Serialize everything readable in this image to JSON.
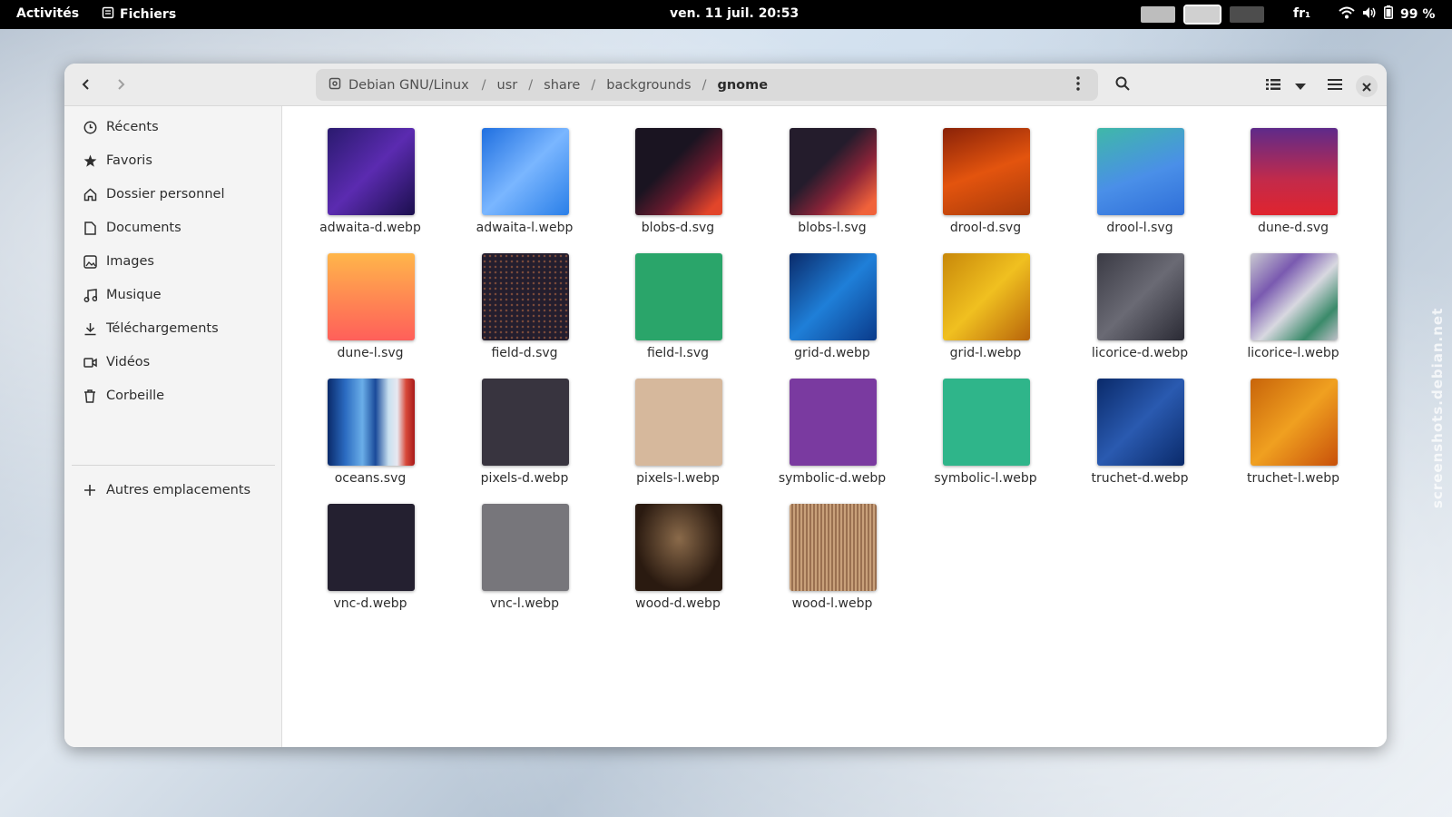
{
  "topbar": {
    "activities": "Activités",
    "app_name": "Fichiers",
    "clock": "ven. 11 juil.  20:53",
    "lang": "fr₁",
    "battery": "99 %"
  },
  "window": {
    "path": {
      "root": "Debian GNU/Linux",
      "segments": [
        "usr",
        "share",
        "backgrounds"
      ],
      "current": "gnome"
    }
  },
  "sidebar": {
    "items": [
      {
        "label": "Récents",
        "icon": "clock-icon"
      },
      {
        "label": "Favoris",
        "icon": "star-icon"
      },
      {
        "label": "Dossier personnel",
        "icon": "home-icon"
      },
      {
        "label": "Documents",
        "icon": "document-icon"
      },
      {
        "label": "Images",
        "icon": "image-icon"
      },
      {
        "label": "Musique",
        "icon": "music-icon"
      },
      {
        "label": "Téléchargements",
        "icon": "download-icon"
      },
      {
        "label": "Vidéos",
        "icon": "video-icon"
      },
      {
        "label": "Corbeille",
        "icon": "trash-icon"
      }
    ],
    "other_locations": "Autres emplacements"
  },
  "files": [
    {
      "name": "adwaita-d.webp",
      "bg": "linear-gradient(135deg,#2a1a6e,#5b2bb0 50%,#1b0f4d)"
    },
    {
      "name": "adwaita-l.webp",
      "bg": "linear-gradient(135deg,#1f6fe0,#7ab6ff 50%,#2a7fe8)"
    },
    {
      "name": "blobs-d.svg",
      "bg": "linear-gradient(135deg,#1a1421 40%,#6b1a2e 65%,#e2452a 90%)"
    },
    {
      "name": "blobs-l.svg",
      "bg": "linear-gradient(135deg,#241c2c 40%,#8a2338 65%,#f0623a 90%)"
    },
    {
      "name": "drool-d.svg",
      "bg": "linear-gradient(160deg,#8a2208,#e3540e 50%,#a83a0a)"
    },
    {
      "name": "drool-l.svg",
      "bg": "linear-gradient(160deg,#3fb8a8,#4a8fe8 55%,#2f6fd8)"
    },
    {
      "name": "dune-d.svg",
      "bg": "linear-gradient(180deg,#5e2a8a,#c32a4a 60%,#e0242e)"
    },
    {
      "name": "dune-l.svg",
      "bg": "linear-gradient(180deg,#ffb64a,#ff8a52 50%,#ff5f5a)"
    },
    {
      "name": "field-d.svg",
      "bg": "radial-gradient(circle,#7a4a3a 1px,transparent 1.5px) 0 0/6px 6px,#241e2e"
    },
    {
      "name": "field-l.svg",
      "bg": "#2aa56a"
    },
    {
      "name": "grid-d.webp",
      "bg": "linear-gradient(135deg,#0a2a6a,#1f7fd8 50%,#0a3a8a)"
    },
    {
      "name": "grid-l.webp",
      "bg": "linear-gradient(135deg,#c8880a,#f0c020 50%,#b8640a)"
    },
    {
      "name": "licorice-d.webp",
      "bg": "linear-gradient(135deg,#3a3a44,#6a6a74 50%,#2a2a34)"
    },
    {
      "name": "licorice-l.webp",
      "bg": "linear-gradient(135deg,#c8c8d0,#7a5ab0 30%,#d8d8e0 55%,#3a8a6a 80%,#c0c0c8)"
    },
    {
      "name": "oceans.svg",
      "bg": "linear-gradient(90deg,#0a2a6a,#2a6ac0 20%,#6aaee8 40%,#1a4a9a 55%,#c8e0f0 70%,#e8e8f0 80%,#d84a3a 90%,#a81a1a)"
    },
    {
      "name": "pixels-d.webp",
      "bg": "#38343f"
    },
    {
      "name": "pixels-l.webp",
      "bg": "#d6b89c"
    },
    {
      "name": "symbolic-d.webp",
      "bg": "#7a3aa0"
    },
    {
      "name": "symbolic-l.webp",
      "bg": "#2fb58a"
    },
    {
      "name": "truchet-d.webp",
      "bg": "linear-gradient(135deg,#0a2a6a,#2a5ab0 50%,#0a2a6a)"
    },
    {
      "name": "truchet-l.webp",
      "bg": "linear-gradient(135deg,#c8640a,#f0a020 50%,#c8500a)"
    },
    {
      "name": "vnc-d.webp",
      "bg": "#242030"
    },
    {
      "name": "vnc-l.webp",
      "bg": "#77767b"
    },
    {
      "name": "wood-d.webp",
      "bg": "radial-gradient(ellipse at 50% 40%,#8a6a4a,#2a1a10 70%)"
    },
    {
      "name": "wood-l.webp",
      "bg": "repeating-linear-gradient(90deg,#c8a07a 0 2px,#9a7050 2px 4px)"
    }
  ],
  "watermark": "screenshots.debian.net"
}
